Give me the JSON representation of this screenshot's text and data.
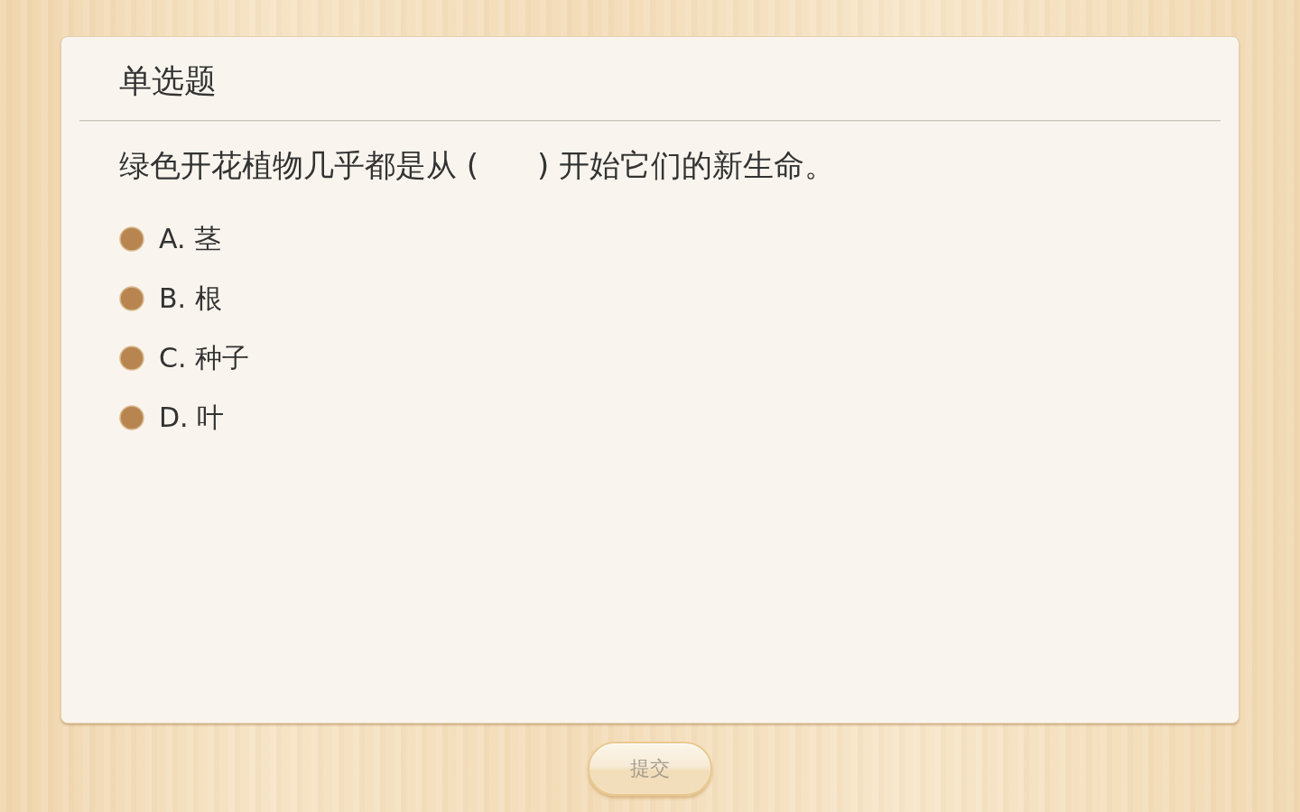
{
  "card": {
    "title": "单选题",
    "question": "绿色开花植物几乎都是从 (      ) 开始它们的新生命。",
    "options": [
      {
        "label": "A. 茎",
        "selected": false
      },
      {
        "label": "B. 根",
        "selected": false
      },
      {
        "label": "C. 种子",
        "selected": false
      },
      {
        "label": "D. 叶",
        "selected": false
      }
    ]
  },
  "submit_button": {
    "label": "提交",
    "disabled": true
  }
}
